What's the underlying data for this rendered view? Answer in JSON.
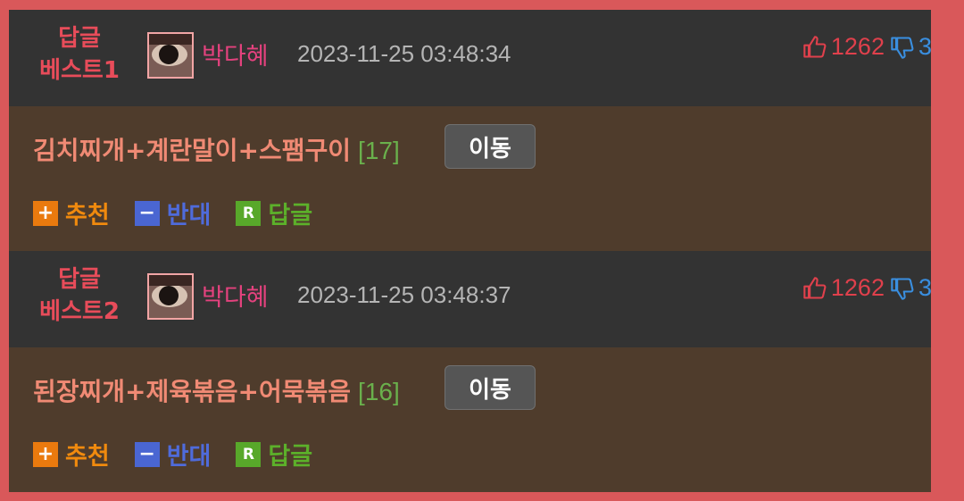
{
  "entries": [
    {
      "best_label": [
        "답글",
        "베스트1"
      ],
      "username": "박다혜",
      "datetime": "2023-11-25 03:48:34",
      "upvotes": "1262",
      "downvotes": "3",
      "title": "김치찌개+계란말이+스팸구이",
      "comment_count": "[17]",
      "move_label": "이동",
      "actions": {
        "recommend": "추천",
        "oppose": "반대",
        "reply": "답글"
      }
    },
    {
      "best_label": [
        "답글",
        "베스트2"
      ],
      "username": "박다혜",
      "datetime": "2023-11-25 03:48:37",
      "upvotes": "1262",
      "downvotes": "3",
      "title": "된장찌개+제육볶음+어묵볶음",
      "comment_count": "[16]",
      "move_label": "이동",
      "actions": {
        "recommend": "추천",
        "oppose": "반대",
        "reply": "답글"
      }
    }
  ],
  "icons": {
    "recommend_box": "+",
    "oppose_box": "−",
    "reply_box": "R",
    "thumb_up": "thumbs-up-icon",
    "thumb_down": "thumbs-down-icon"
  },
  "colors": {
    "frame_border": "#d9585a",
    "header_bg": "#333333",
    "body_bg": "#4f3c2c",
    "best_label": "#e84c5a",
    "username": "#e4427e",
    "upvote": "#e0404c",
    "downvote": "#3a8fe0"
  }
}
